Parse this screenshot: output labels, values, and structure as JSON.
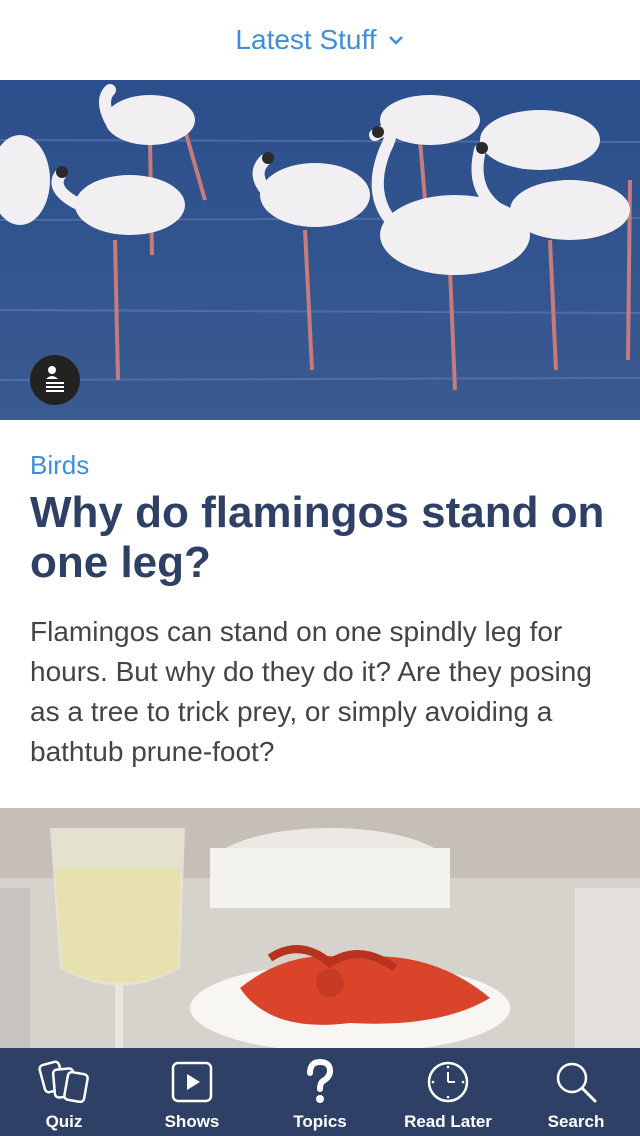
{
  "header": {
    "title": "Latest Stuff",
    "dropdown_icon": "chevron-down-icon",
    "accent": "#3f8ed8"
  },
  "hero": {
    "image": "flamingos-in-water",
    "info_icon": "person-info-icon"
  },
  "article": {
    "category": "Birds",
    "headline": "Why do flamingos stand on one leg?",
    "summary": "Flamingos can stand on one spindly leg for hours. But why do they do it? Are they posing as a tree to trick prey, or simply avoiding a bathtub prune-foot?"
  },
  "next_card": {
    "image": "lobster-dinner-table"
  },
  "tabbar": {
    "background": "#2f4066",
    "tabs": [
      {
        "label": "Quiz",
        "icon": "cards-icon"
      },
      {
        "label": "Shows",
        "icon": "play-icon"
      },
      {
        "label": "Topics",
        "icon": "question-mark-icon"
      },
      {
        "label": "Read Later",
        "icon": "clock-icon"
      },
      {
        "label": "Search",
        "icon": "search-icon"
      }
    ]
  }
}
